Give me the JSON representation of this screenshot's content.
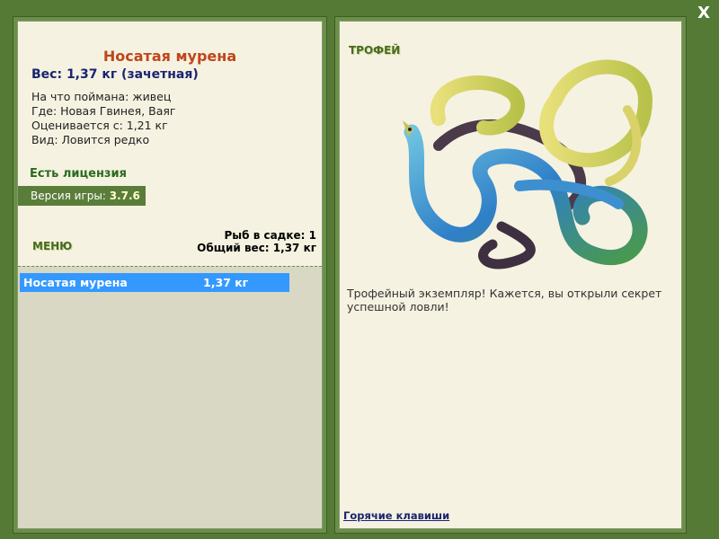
{
  "close_label": "X",
  "fish": {
    "title": "Носатая мурена",
    "weight": "Вес: 1,37 кг (зачетная)",
    "info": [
      "На что поймана: живец",
      "Где: Новая Гвинея, Ваяг",
      "Оценивается с: 1,21 кг",
      "Вид: Ловится редко"
    ]
  },
  "license": "Есть лицензия",
  "version": {
    "label": "Версия игры: ",
    "value": "3.7.6"
  },
  "menu_label": "МЕНЮ",
  "stats": {
    "count": "Рыб в садке: 1",
    "total": "Общий вес: 1,37 кг"
  },
  "catch_list": [
    {
      "name": "Носатая мурена",
      "weight": "1,37 кг"
    }
  ],
  "trophy": {
    "label": "ТРОФЕЙ",
    "text": "Трофейный экземпляр! Кажется, вы открыли секрет успешной ловли!",
    "image": "ribbon-eel-picture"
  },
  "hotkeys_label": "Горячие клавиши",
  "colors": {
    "background": "#557a35",
    "panel": "#f5f2e1",
    "title": "#c0451b",
    "selected_row": "#3399ff"
  }
}
